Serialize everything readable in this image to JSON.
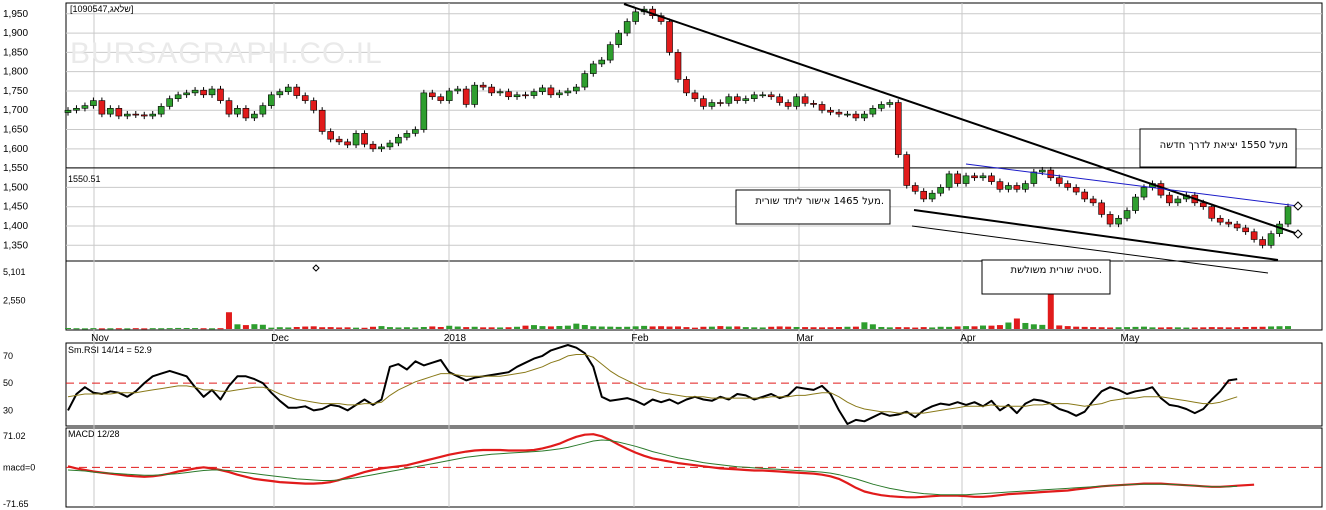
{
  "header": {
    "symbol": "[1090547,שלאג]",
    "watermark": "BURSAGRAPH.CO.IL"
  },
  "colors": {
    "up": "#2e9e2e",
    "down": "#e11b1b",
    "trend": "#000000",
    "channel": "#1a1ac8",
    "ref_line": "#e11b1b",
    "signal": "#8a7a1a",
    "macd_signal": "#2b7a2b"
  },
  "chart_data": [
    {
      "type": "candlestick",
      "name": "price",
      "x_labels": [
        "Nov",
        "Dec",
        "2018",
        "Feb",
        "Mar",
        "Apr",
        "May"
      ],
      "y_ticks": [
        "1,950",
        "1,900",
        "1,850",
        "1,800",
        "1,750",
        "1,700",
        "1,650",
        "1,600",
        "1,550",
        "1,500",
        "1,450",
        "1,400",
        "1,350"
      ],
      "ylim": [
        1330,
        1965
      ],
      "reference_line": {
        "label": "1550.51",
        "value": 1550.51
      },
      "grid": true,
      "closes": [
        1700,
        1705,
        1712,
        1725,
        1690,
        1705,
        1685,
        1690,
        1688,
        1685,
        1690,
        1710,
        1730,
        1740,
        1745,
        1752,
        1740,
        1755,
        1725,
        1690,
        1705,
        1680,
        1690,
        1712,
        1740,
        1748,
        1760,
        1738,
        1725,
        1700,
        1645,
        1625,
        1618,
        1610,
        1640,
        1612,
        1600,
        1605,
        1615,
        1630,
        1640,
        1650,
        1745,
        1735,
        1725,
        1750,
        1755,
        1715,
        1765,
        1760,
        1745,
        1748,
        1735,
        1740,
        1738,
        1748,
        1758,
        1740,
        1745,
        1750,
        1760,
        1795,
        1820,
        1830,
        1870,
        1900,
        1930,
        1955,
        1962,
        1945,
        1930,
        1850,
        1780,
        1745,
        1730,
        1710,
        1720,
        1718,
        1735,
        1725,
        1730,
        1740,
        1740,
        1735,
        1720,
        1710,
        1735,
        1718,
        1715,
        1700,
        1695,
        1690,
        1690,
        1680,
        1690,
        1705,
        1715,
        1720,
        1585,
        1505,
        1490,
        1470,
        1485,
        1500,
        1535,
        1510,
        1530,
        1525,
        1530,
        1515,
        1495,
        1505,
        1495,
        1510,
        1540,
        1545,
        1525,
        1510,
        1500,
        1488,
        1470,
        1460,
        1430,
        1405,
        1420,
        1440,
        1475,
        1500,
        1510,
        1480,
        1460,
        1470,
        1480,
        1460,
        1450,
        1420,
        1410,
        1405,
        1395,
        1385,
        1365,
        1350,
        1380,
        1405,
        1450
      ],
      "volume_ticks": [
        "5,101",
        "2,550"
      ],
      "volume_max": 5101,
      "volume": [
        90,
        70,
        60,
        80,
        60,
        65,
        70,
        60,
        75,
        60,
        75,
        70,
        80,
        95,
        90,
        85,
        70,
        65,
        75,
        1500,
        420,
        350,
        430,
        380,
        120,
        160,
        140,
        180,
        220,
        240,
        160,
        170,
        140,
        150,
        120,
        110,
        200,
        260,
        170,
        140,
        160,
        140,
        180,
        230,
        180,
        290,
        220,
        170,
        200,
        150,
        150,
        140,
        160,
        200,
        300,
        350,
        260,
        230,
        270,
        300,
        480,
        360,
        250,
        220,
        210,
        190,
        200,
        240,
        280,
        230,
        250,
        220,
        230,
        170,
        120,
        200,
        210,
        260,
        220,
        230,
        170,
        150,
        140,
        200,
        230,
        210,
        180,
        170,
        160,
        150,
        160,
        180,
        200,
        210,
        600,
        420,
        180,
        150,
        170,
        160,
        130,
        170,
        140,
        200,
        190,
        230,
        260,
        240,
        310,
        300,
        350,
        580,
        940,
        540,
        420,
        370,
        5101,
        320,
        260,
        210,
        190,
        170,
        160,
        140,
        160,
        170,
        190,
        210,
        150,
        140,
        160,
        150,
        130,
        140,
        150,
        170,
        160,
        150,
        160,
        180,
        190,
        200,
        230,
        250,
        260
      ]
    },
    {
      "type": "line",
      "name": "rsi",
      "title": "Sm.RSI 14/14 = 52.9",
      "y_ticks": [
        "70",
        "50",
        "30"
      ],
      "ylim": [
        20,
        78
      ],
      "reference_value": 50,
      "series": [
        {
          "values": [
            30,
            42,
            47,
            43,
            42,
            44,
            43,
            40,
            44,
            50,
            55,
            57,
            59,
            57,
            55,
            47,
            40,
            45,
            38,
            48,
            55,
            55,
            53,
            50,
            43,
            37,
            32,
            32,
            33,
            30,
            31,
            34,
            33,
            30,
            34,
            38,
            34,
            38,
            62,
            64,
            60,
            66,
            63,
            65,
            67,
            58,
            55,
            52,
            54,
            55,
            56,
            57,
            58,
            62,
            65,
            68,
            70,
            74,
            76,
            78,
            76,
            72,
            62,
            40,
            37,
            38,
            39,
            37,
            34,
            38,
            36,
            38,
            35,
            38,
            40,
            38,
            37,
            40,
            38,
            42,
            41,
            38,
            40,
            42,
            39,
            41,
            47,
            46,
            45,
            48,
            42,
            30,
            20,
            23,
            22,
            25,
            28,
            26,
            27,
            29,
            25,
            30,
            33,
            35,
            34,
            36,
            34,
            36,
            33,
            37,
            30,
            34,
            28,
            35,
            38,
            37,
            35,
            31,
            29,
            26,
            29,
            37,
            44,
            47,
            45,
            42,
            44,
            45,
            47,
            39,
            34,
            33,
            31,
            28,
            31,
            38,
            44,
            52,
            53
          ]
        },
        {
          "name": "",
          "values": [
            40,
            41,
            42,
            42,
            42,
            42,
            43,
            43,
            43,
            44,
            45,
            46,
            47,
            48,
            48,
            47,
            45,
            45,
            44,
            44,
            45,
            46,
            47,
            47,
            45,
            42,
            40,
            38,
            37,
            36,
            35,
            35,
            35,
            34,
            34,
            35,
            35,
            36,
            41,
            45,
            48,
            51,
            53,
            55,
            57,
            57,
            56,
            55,
            55,
            55,
            55,
            55,
            56,
            57,
            58,
            60,
            62,
            65,
            67,
            70,
            71,
            71,
            69,
            64,
            59,
            55,
            52,
            49,
            46,
            45,
            43,
            42,
            41,
            40,
            40,
            40,
            39,
            39,
            39,
            39,
            39,
            39,
            39,
            40,
            40,
            40,
            41,
            41,
            42,
            43,
            43,
            40,
            36,
            33,
            31,
            30,
            29,
            29,
            28,
            28,
            28,
            28,
            29,
            30,
            31,
            32,
            33,
            33,
            33,
            34,
            33,
            33,
            33,
            33,
            34,
            34,
            35,
            35,
            35,
            34,
            33,
            34,
            35,
            37,
            38,
            39,
            39,
            40,
            40,
            40,
            39,
            38,
            37,
            36,
            35,
            35,
            36,
            38,
            40
          ]
        }
      ]
    },
    {
      "type": "line",
      "name": "macd",
      "title": "MACD 12/28",
      "y_ticks": [
        "71.02",
        "macd=0",
        "-71.65"
      ],
      "ylim": [
        -71.65,
        71.02
      ],
      "reference_value": 0,
      "series": [
        {
          "values": [
            2,
            -2,
            -5,
            -8,
            -10,
            -12,
            -14,
            -16,
            -17,
            -18,
            -17,
            -15,
            -12,
            -8,
            -5,
            -2,
            0,
            -2,
            -5,
            -9,
            -14,
            -18,
            -22,
            -24,
            -26,
            -28,
            -29,
            -30,
            -31,
            -31,
            -30,
            -28,
            -24,
            -19,
            -14,
            -9,
            -5,
            -2,
            0,
            2,
            4,
            8,
            12,
            16,
            20,
            24,
            27,
            30,
            32,
            33,
            33,
            33,
            32,
            32,
            32,
            33,
            36,
            40,
            45,
            52,
            58,
            62,
            63,
            59,
            52,
            43,
            35,
            28,
            22,
            17,
            14,
            11,
            8,
            6,
            4,
            2,
            0,
            -2,
            -3,
            -4,
            -5,
            -6,
            -6,
            -7,
            -8,
            -9,
            -10,
            -11,
            -12,
            -14,
            -17,
            -22,
            -30,
            -39,
            -46,
            -50,
            -53,
            -55,
            -56,
            -57,
            -57,
            -56,
            -55,
            -54,
            -54,
            -54,
            -55,
            -56,
            -56,
            -55,
            -53,
            -51,
            -50,
            -49,
            -48,
            -47,
            -46,
            -45,
            -44,
            -42,
            -40,
            -38,
            -36,
            -35,
            -34,
            -33,
            -32,
            -31,
            -31,
            -31,
            -32,
            -33,
            -34,
            -35,
            -36,
            -37,
            -37,
            -36,
            -35,
            -34,
            -33
          ]
        },
        {
          "name": "",
          "values": [
            -5,
            -6,
            -7,
            -9,
            -10,
            -11,
            -12,
            -13,
            -14,
            -15,
            -15,
            -14,
            -13,
            -12,
            -10,
            -8,
            -6,
            -5,
            -5,
            -6,
            -8,
            -10,
            -12,
            -14,
            -16,
            -18,
            -20,
            -22,
            -23,
            -24,
            -25,
            -25,
            -24,
            -22,
            -20,
            -17,
            -14,
            -11,
            -8,
            -5,
            -2,
            1,
            4,
            7,
            10,
            13,
            16,
            19,
            21,
            23,
            25,
            26,
            27,
            28,
            29,
            30,
            31,
            33,
            35,
            38,
            42,
            46,
            50,
            52,
            51,
            48,
            44,
            40,
            35,
            30,
            26,
            22,
            18,
            15,
            12,
            9,
            7,
            5,
            3,
            1,
            0,
            -1,
            -2,
            -3,
            -4,
            -5,
            -6,
            -7,
            -8,
            -9,
            -11,
            -14,
            -18,
            -22,
            -27,
            -32,
            -36,
            -40,
            -43,
            -46,
            -48,
            -50,
            -51,
            -52,
            -52,
            -52,
            -52,
            -51,
            -50,
            -49,
            -48,
            -47,
            -46,
            -45,
            -44,
            -43,
            -42,
            -41,
            -40,
            -39,
            -38,
            -37,
            -36,
            -35,
            -34,
            -33,
            -32,
            -32,
            -32,
            -32,
            -32,
            -33,
            -34,
            -35,
            -36,
            -37,
            -37,
            -37,
            -36
          ]
        }
      ]
    }
  ],
  "annotations": {
    "note_1550": "מעל 1550 יציאת לדרך חדשה",
    "note_1465": "מעל 1465 אישור ליתד שורית.",
    "note_divergence": "סטיה שורית משולשת."
  }
}
